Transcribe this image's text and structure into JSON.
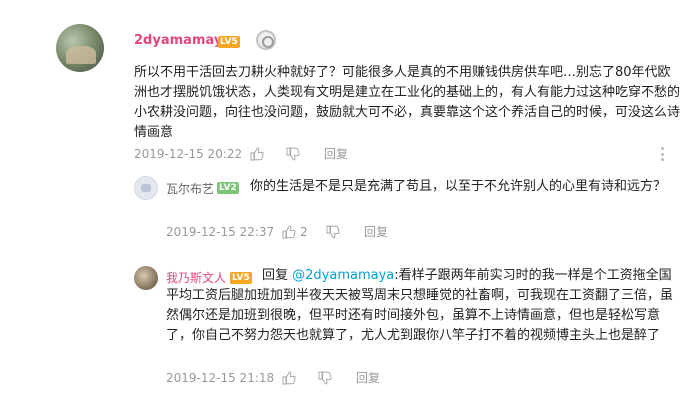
{
  "comment": {
    "username": "2dyamamaya",
    "level": "LV5",
    "text": "所以不用干活回去刀耕火种就好了？可能很多人是真的不用赚钱供房供车吧…别忘了80年代欧洲也才摆脱饥饿状态，人类现有文明是建立在工业化的基础上的，有人有能力过这种吃穿不愁的小农耕没问题，向往也没问题，鼓励就大可不必，真要靠这个这个养活自己的时候，可没这么诗情画意",
    "time": "2019-12-15 20:22",
    "reply_label": "回复",
    "colors": {
      "username": "#e6467d",
      "meta": "#999999",
      "level": "#f5a623"
    }
  },
  "replies": [
    {
      "username": "瓦尔布艺",
      "level": "LV2",
      "text": "你的生活是不是只是充满了苟且，以至于不允许别人的心里有诗和远方？",
      "time": "2019-12-15 22:37",
      "likes": "2",
      "reply_label": "回复",
      "colors": {
        "username": "#666666",
        "level": "#7cc576"
      }
    },
    {
      "username": "我乃斯文人",
      "level": "LV5",
      "reply_prefix": "回复 ",
      "mention": "@2dyamamaya",
      "text": ":看样子跟两年前实习时的我一样是个工资拖全国平均工资后腿加班加到半夜天天被骂周末只想睡觉的社畜啊，可我现在工资翻了三倍，虽然偶尔还是加班到很晚，但平时还有时间接外包，虽算不上诗情画意，但也是轻松写意了，你自己不努力怨天也就算了，尤人尤到跟你八竿子打不着的视频博主头上也是醉了",
      "time": "2019-12-15 21:18",
      "reply_label": "回复",
      "colors": {
        "username": "#e6467d",
        "mention": "#00a1d6",
        "level": "#f5a623"
      }
    }
  ],
  "icons": [
    "avatar",
    "medal-icon",
    "thumb-up-icon",
    "thumb-down-icon",
    "more-icon"
  ]
}
